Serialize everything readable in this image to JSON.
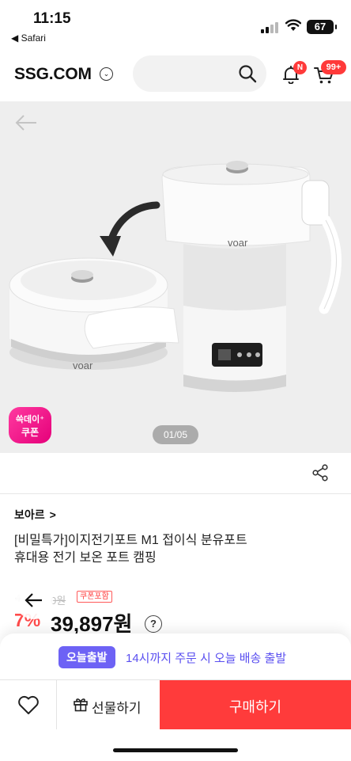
{
  "status_bar": {
    "time": "11:15",
    "back_app": "◀ Safari",
    "battery": "67"
  },
  "header": {
    "logo": "SSG.COM",
    "notification_badge": "N",
    "cart_badge": "99+"
  },
  "gallery": {
    "page_counter": "01/05",
    "coupon_line1": "쓱데이⁺",
    "coupon_line2": "쿠폰",
    "product_brand_mark": "voar"
  },
  "product": {
    "brand": "보아르",
    "brand_chevron": ">",
    "title_line1": "[비밀특가]이지전기포트 M1 접이식 분유포트",
    "title_line2": "휴대용 전기 보온 포트 캠핑",
    "original_price_prefix": "4",
    "original_price": "0원",
    "coupon_included": "쿠폰포함",
    "discount_rate": "7%",
    "sale_price": "39,897원",
    "help": "?"
  },
  "delivery": {
    "badge": "오늘출발",
    "text": "14시까지 주문 시 오늘 배송 출발"
  },
  "actions": {
    "gift_label": "선물하기",
    "buy_label": "구매하기"
  },
  "colors": {
    "accent_red": "#ff3b3b",
    "delivery_purple": "#6d62f5"
  }
}
